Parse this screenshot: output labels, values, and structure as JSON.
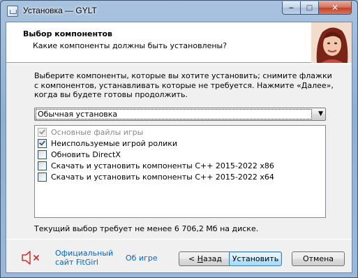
{
  "window": {
    "title": "Установка — GYLT",
    "controls": {
      "minimize": "‒",
      "maximize": "□",
      "close": "✕"
    }
  },
  "header": {
    "title": "Выбор компонентов",
    "subtitle": "Какие компоненты должны быть установлены?"
  },
  "description": "Выберите компоненты, которые вы хотите установить; снимите флажки с компонентов, устанавливать которые не требуется. Нажмите «Далее», когда вы будете готовы продолжить.",
  "install_type": {
    "selected": "Обычная установка"
  },
  "components": [
    {
      "label": "Основные файлы игры",
      "checked": true,
      "disabled": true
    },
    {
      "label": "Неиспользуемые игрой ролики",
      "checked": true,
      "disabled": false
    },
    {
      "label": "Обновить DirectX",
      "checked": false,
      "disabled": false
    },
    {
      "label": "Скачать и установить компоненты C++ 2015-2022 x86",
      "checked": false,
      "disabled": false
    },
    {
      "label": "Скачать и установить компоненты C++ 2015-2022 x64",
      "checked": false,
      "disabled": false
    }
  ],
  "disk_requirement": "Текущий выбор требует не менее 6 706,2 Мб на диске.",
  "links": {
    "fitgirl_line1": "Официальный",
    "fitgirl_line2": "сайт FitGirl",
    "about_game": "Об игре"
  },
  "buttons": {
    "back_prefix": "< ",
    "back_accel": "Н",
    "back_rest": "азад",
    "install": "Установить",
    "cancel": "Отмена"
  },
  "colors": {
    "link": "#0066cc",
    "speaker_red": "#d32f2f"
  },
  "icons": {
    "app": "installer-icon",
    "speaker": "speaker-muted-icon",
    "dropdown": "chevron-down-icon"
  }
}
